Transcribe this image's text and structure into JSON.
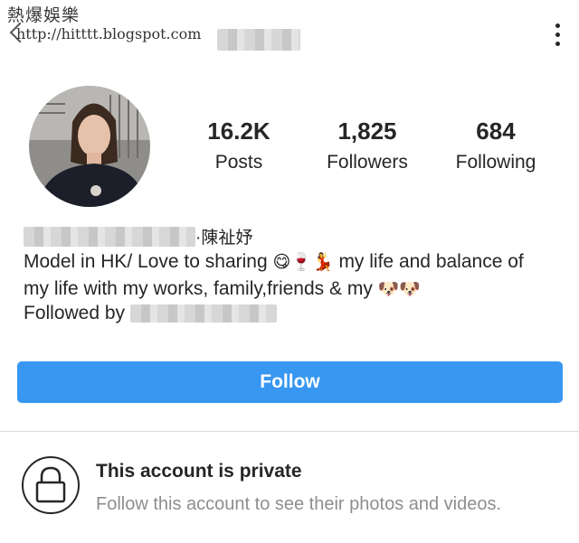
{
  "watermark": {
    "title": "熱爆娛樂",
    "url": "http://hitttt.blogspot.com"
  },
  "header": {
    "back_icon": "chevron-left-icon",
    "menu_icon": "more-vertical-icon"
  },
  "profile": {
    "stats": [
      {
        "value": "16.2K",
        "label": "Posts"
      },
      {
        "value": "1,825",
        "label": "Followers"
      },
      {
        "value": "684",
        "label": "Following"
      }
    ],
    "name_suffix": "·陳祉妤",
    "bio_line1_text": "Model in HK/ Love to sharing ",
    "bio_line1_emojis": "😋🍷💃",
    "bio_line1_tail": " my life and balance of",
    "bio_line2_text": "my life with my works, family,friends & my ",
    "bio_line2_emojis": "🐶🐶",
    "followed_by_label": "Followed by"
  },
  "actions": {
    "follow_label": "Follow"
  },
  "private_notice": {
    "title": "This account is private",
    "subtitle": "Follow this account to see their photos and videos.",
    "icon": "lock-icon"
  },
  "colors": {
    "follow_button": "#3897f0",
    "text_primary": "#262626",
    "text_secondary": "#8e8e8e",
    "divider": "#dbdbdb"
  }
}
